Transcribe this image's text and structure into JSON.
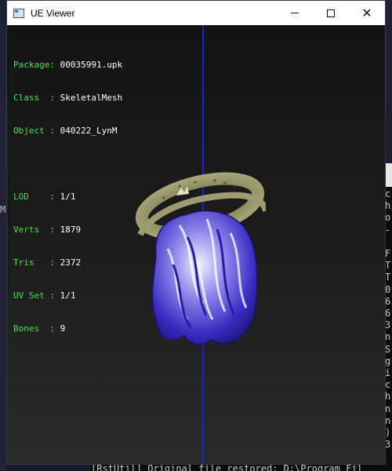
{
  "window": {
    "title": "UE Viewer",
    "controls": {
      "minimize": "",
      "maximize": "",
      "close": "✕"
    }
  },
  "info": {
    "package_key": "Package: ",
    "package": "00035991.upk",
    "class_key": "Class  : ",
    "class": "SkeletalMesh",
    "object_key": "Object : ",
    "object": "040222_LynM",
    "lod_key": "LOD    : ",
    "lod": "1/1",
    "verts_key": "Verts  : ",
    "verts": "1879",
    "tris_key": "Tris   : ",
    "tris": "2372",
    "uvset_key": "UV Set : ",
    "uvset": "1/1",
    "bones_key": "Bones  : ",
    "bones": "9"
  },
  "background": {
    "left_letter": "M",
    "console_column": "c\nh\no\n-\n\nF\nT\nT\n0\n6\n6\n3\nn\nS\ng\ni\nc\nh\nn\nn\n)\n3",
    "console_bottom": "[RstUtil] Original file restored: D:\\Program Fil"
  },
  "colors": {
    "label_green": "#4be04b",
    "axis_blue": "#1a22c8",
    "viewport_bg": "#1c1c1c"
  }
}
